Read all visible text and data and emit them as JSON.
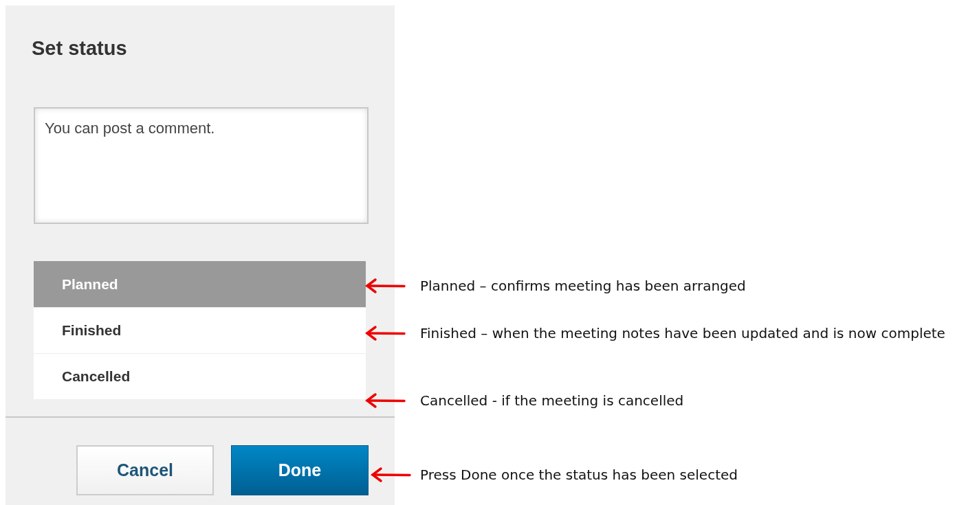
{
  "dialog": {
    "title": "Set status",
    "comment": {
      "placeholder": "You can post a comment."
    },
    "statuses": [
      {
        "label": "Planned",
        "selected": true
      },
      {
        "label": "Finished",
        "selected": false
      },
      {
        "label": "Cancelled",
        "selected": false
      }
    ],
    "buttons": [
      {
        "label": "Cancel",
        "kind": "secondary"
      },
      {
        "label": "Done",
        "kind": "primary"
      }
    ]
  },
  "annotations": [
    {
      "text": "Planned – confirms meeting has been arranged"
    },
    {
      "text": "Finished – when the meeting notes have been updated and is now complete"
    },
    {
      "text": "Cancelled - if the meeting is cancelled"
    },
    {
      "text": "Press Done once the status has been selected"
    }
  ]
}
